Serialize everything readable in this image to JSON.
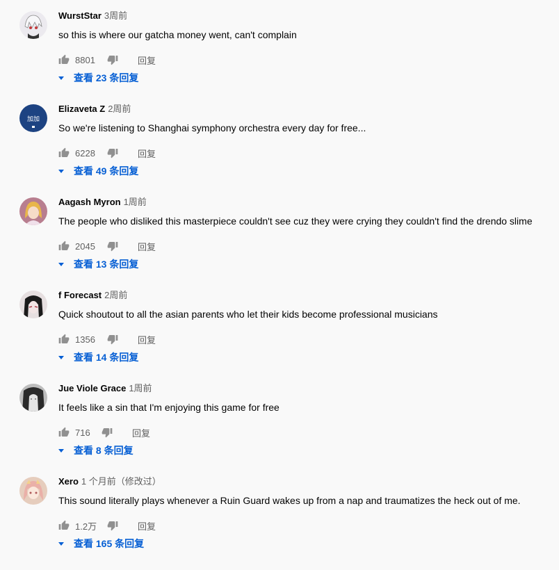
{
  "reply_label": "回复",
  "comments": [
    {
      "author": "WurstStar",
      "time": "3周前",
      "text": "so this is where our gatcha money went, can't complain",
      "likes": "8801",
      "view_replies": "查看 23 条回复"
    },
    {
      "author": "Elizaveta Z",
      "time": "2周前",
      "text": "So we're listening to Shanghai symphony orchestra every day for free...",
      "likes": "6228",
      "view_replies": "查看 49 条回复"
    },
    {
      "author": "Aagash Myron",
      "time": "1周前",
      "text": "The people who disliked this masterpiece couldn't see cuz they were crying they couldn't find the drendo slime",
      "likes": "2045",
      "view_replies": "查看 13 条回复"
    },
    {
      "author": "f Forecast",
      "time": "2周前",
      "text": "Quick shoutout to all the asian parents who let their kids become professional musicians",
      "likes": "1356",
      "view_replies": "查看 14 条回复"
    },
    {
      "author": "Jue Viole Grace",
      "time": "1周前",
      "text": "It feels like a sin that I'm enjoying this game for free",
      "likes": "716",
      "view_replies": "查看 8 条回复"
    },
    {
      "author": "Xero",
      "time": "1 个月前（修改过）",
      "text": "This sound literally plays whenever a Ruin Guard wakes up from a nap and traumatizes the heck out of me.",
      "likes": "1.2万",
      "view_replies": "查看 165 条回复"
    }
  ],
  "avatars": [
    {
      "icon": "anime-white-hair-avatar-icon",
      "bg": "#e9e6ec"
    },
    {
      "icon": "blue-logo-avatar-icon",
      "bg": "#1d4382"
    },
    {
      "icon": "blonde-character-avatar-icon",
      "bg": "#b87e8f"
    },
    {
      "icon": "dark-hair-character-avatar-icon",
      "bg": "#d8d0d2"
    },
    {
      "icon": "grayscale-character-avatar-icon",
      "bg": "#9a9a9a"
    },
    {
      "icon": "pink-hair-character-avatar-icon",
      "bg": "#e2c6b5"
    }
  ]
}
